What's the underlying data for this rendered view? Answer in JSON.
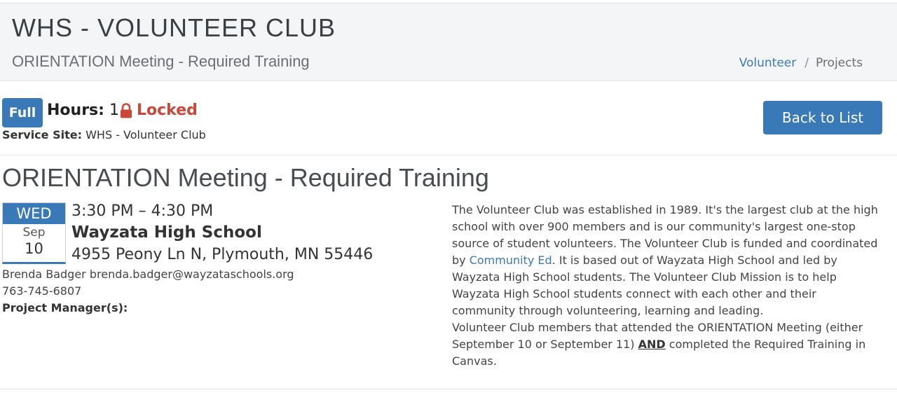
{
  "header": {
    "title": "WHS - VOLUNTEER CLUB",
    "subtitle": "ORIENTATION Meeting - Required Training",
    "breadcrumb": {
      "volunteer": "Volunteer",
      "separator": "/",
      "projects": "Projects"
    }
  },
  "status": {
    "badge": "Full",
    "hours_label": "Hours:",
    "hours_value": "1",
    "locked_label": "Locked",
    "service_site_label": "Service Site:",
    "service_site_value": "WHS - Volunteer Club"
  },
  "actions": {
    "back_to_list": "Back to List"
  },
  "event": {
    "title": "ORIENTATION Meeting - Required Training",
    "calendar": {
      "day": "WED",
      "month": "Sep",
      "date": "10"
    },
    "time": "3:30 PM – 4:30 PM",
    "location_name": "Wayzata High School",
    "address": "4955 Peony Ln N, Plymouth, MN 55446",
    "contact": "Brenda Badger brenda.badger@wayzataschools.org",
    "phone": "763-745-6807",
    "project_managers_label": "Project Manager(s):"
  },
  "description": {
    "part1": "The Volunteer Club was established in 1989. It's the largest club at the high school with over 900 members and is our community's largest one-stop source of student volunteers. The Volunteer Club is funded and coordinated by ",
    "link": "Community Ed",
    "part2": ". It is based out of Wayzata High School and led by Wayzata High School students. The Volunteer Club Mission is to help Wayzata High School students connect with each other and their community through volunteering, learning and leading.",
    "part3": "Volunteer Club members that attended the ORIENTATION Meeting (either September 10 or September 11) ",
    "and": "AND",
    "part4": " completed the Required Training in Canvas."
  },
  "colors": {
    "primary": "#3a79b8",
    "locked": "#c9483a",
    "link": "#3b7ab5",
    "header_bg": "#f4f5f7"
  },
  "icons": {
    "locked": "lock-icon"
  }
}
